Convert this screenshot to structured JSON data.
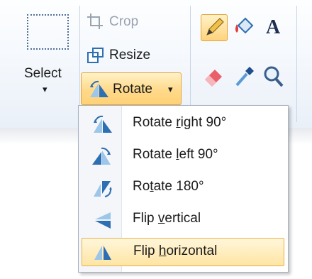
{
  "toolbar": {
    "select_label": "Select",
    "crop_label": "Crop",
    "resize_label": "Resize",
    "rotate_label": "Rotate",
    "rotate_arrow": "▾",
    "select_arrow": "▾"
  },
  "tools": [
    {
      "icon": "pencil-icon",
      "active": true
    },
    {
      "icon": "fill-bucket-icon",
      "active": false
    },
    {
      "icon": "text-icon",
      "active": false,
      "glyph": "A"
    },
    {
      "icon": "eraser-icon",
      "active": false
    },
    {
      "icon": "color-picker-icon",
      "active": false
    },
    {
      "icon": "magnifier-icon",
      "active": false
    }
  ],
  "rotate_menu": {
    "items": [
      {
        "pre": "Rotate ",
        "mnemonic": "r",
        "post": "ight 90°",
        "icon": "rotate-right-icon",
        "highlighted": false
      },
      {
        "pre": "Rotate ",
        "mnemonic": "l",
        "post": "eft 90°",
        "icon": "rotate-left-icon",
        "highlighted": false
      },
      {
        "pre": "Ro",
        "mnemonic": "t",
        "post": "ate 180°",
        "icon": "rotate-180-icon",
        "highlighted": false
      },
      {
        "pre": "Flip ",
        "mnemonic": "v",
        "post": "ertical",
        "icon": "flip-vertical-icon",
        "highlighted": false
      },
      {
        "pre": "Flip ",
        "mnemonic": "h",
        "post": "orizontal",
        "icon": "flip-horizontal-icon",
        "highlighted": true
      }
    ]
  },
  "colors": {
    "highlight_border": "#e3a33a",
    "highlight_fill": "#ffd98a",
    "icon_blue": "#2d6fb3",
    "icon_light_blue": "#9cc6ea"
  }
}
